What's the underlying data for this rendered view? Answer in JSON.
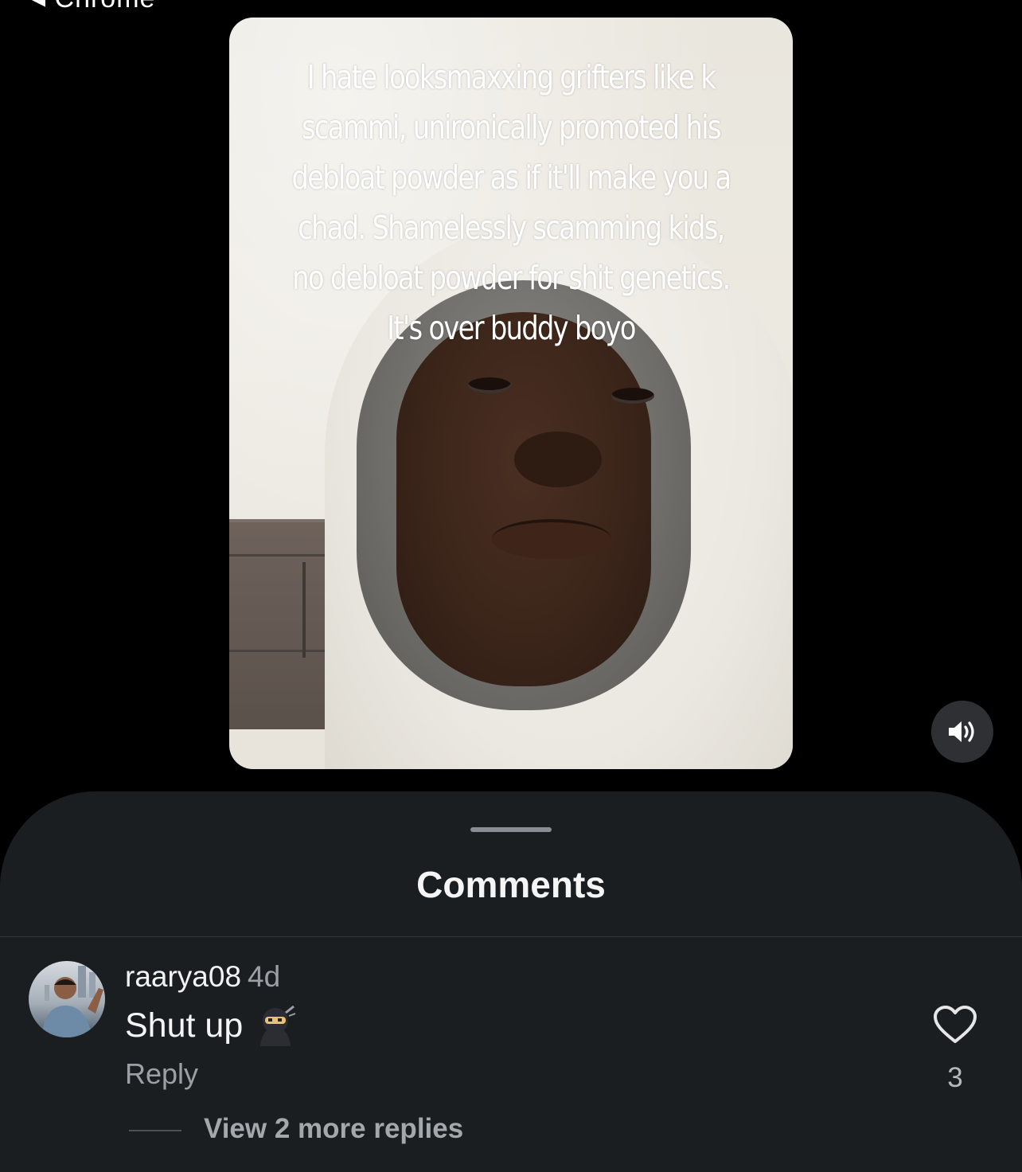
{
  "status_bar": {
    "back_label": "◂ Chrome"
  },
  "video": {
    "caption": "I hate looksmaxxing grifters like k scammi, unironically promoted his debloat powder as if it'll make you a chad. Shamelessly scamming kids, no debloat powder for shit genetics. It's over buddy boyo",
    "sound_icon": "speaker-on-icon"
  },
  "comments_sheet": {
    "title": "Comments",
    "comments": [
      {
        "username": "raarya08",
        "time": "4d",
        "text": "Shut up",
        "emoji": "ninja-emoji",
        "reply_label": "Reply",
        "like_count": "3",
        "view_more_label": "View 2 more replies"
      }
    ]
  },
  "colors": {
    "sheet_bg": "#1b1e21",
    "page_bg": "#000000",
    "muted_text": "#9aa0a6"
  }
}
